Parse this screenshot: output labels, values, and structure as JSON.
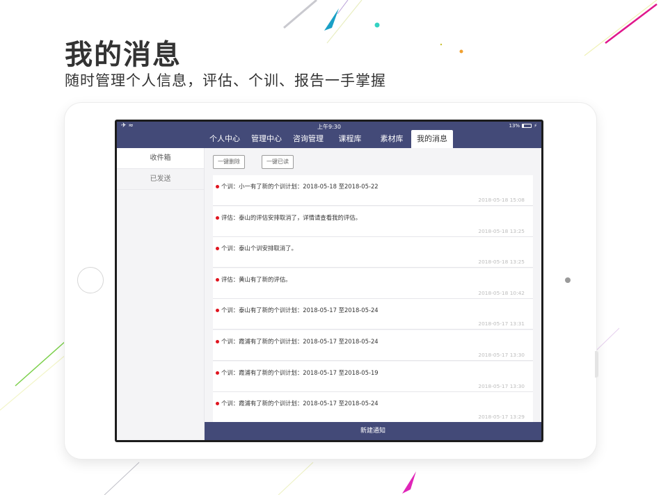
{
  "promo": {
    "headline": "我的消息",
    "subline": "随时管理个人信息，评估、个训、报告一手掌握"
  },
  "status_bar": {
    "left": "✈ ≈",
    "time": "上午9:30",
    "battery_text": "13%",
    "charge": "⚡"
  },
  "nav": {
    "tabs": [
      {
        "label": "个人中心",
        "active": false
      },
      {
        "label": "管理中心",
        "active": false
      },
      {
        "label": "咨询管理",
        "active": false
      },
      {
        "label": "课程库",
        "active": false
      },
      {
        "label": "素材库",
        "active": false
      },
      {
        "label": "我的消息",
        "active": true
      }
    ]
  },
  "sidebar": {
    "items": [
      {
        "label": "收件箱",
        "active": true
      },
      {
        "label": "已发送",
        "active": false
      }
    ]
  },
  "toolbar": {
    "delete_all_label": "一键删除",
    "read_all_label": "一键已读"
  },
  "messages": [
    {
      "text": "个训：小一有了新的个训计划：2018-05-18 至2018-05-22",
      "time": "2018-05-18 15:08",
      "unread": true
    },
    {
      "text": "评估：泰山的评估安排取消了，详情请查看我的评估。",
      "time": "2018-05-18 13:25",
      "unread": true
    },
    {
      "text": "个训：泰山个训安排取消了。",
      "time": "2018-05-18 13:25",
      "unread": true
    },
    {
      "text": "评估：黄山有了新的评估。",
      "time": "2018-05-18 10:42",
      "unread": true
    },
    {
      "text": "个训：泰山有了新的个训计划：2018-05-17 至2018-05-24",
      "time": "2018-05-17 13:31",
      "unread": true
    },
    {
      "text": "个训：霞浦有了新的个训计划：2018-05-17 至2018-05-24",
      "time": "2018-05-17 13:30",
      "unread": true
    },
    {
      "text": "个训：霞浦有了新的个训计划：2018-05-17 至2018-05-19",
      "time": "2018-05-17 13:30",
      "unread": true
    },
    {
      "text": "个训：霞浦有了新的个训计划：2018-05-17 至2018-05-24",
      "time": "2018-05-17 13:29",
      "unread": true
    }
  ],
  "footer": {
    "new_notice_label": "新建通知"
  },
  "colors": {
    "nav_bg": "#434a78",
    "unread_dot": "#e0141e"
  }
}
